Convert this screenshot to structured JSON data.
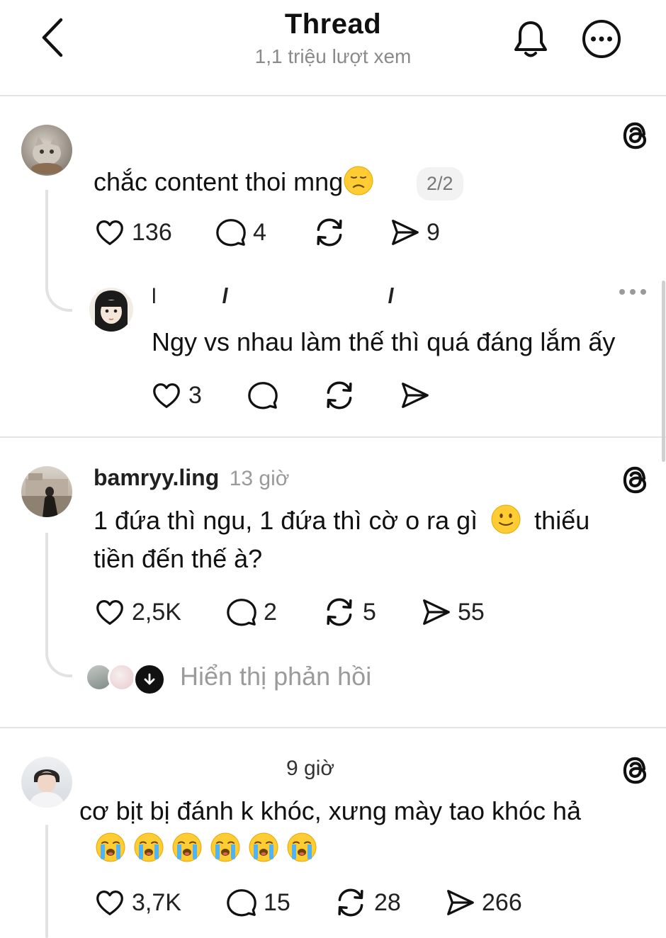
{
  "header": {
    "title": "Thread",
    "subtitle": "1,1 triệu lượt xem"
  },
  "posts": [
    {
      "text": "chắc content thoi mng",
      "page_badge": "2/2",
      "likes": "136",
      "comments": "4",
      "reposts": "",
      "shares": "9"
    },
    {
      "username": "l",
      "text": "Ngy vs nhau làm thế thì quá đáng lắm ấy",
      "likes": "3",
      "comments": "",
      "reposts": "",
      "shares": ""
    },
    {
      "username": "bamryy.ling",
      "time": "13 giờ",
      "text_line1": "1 đứa thì ngu, 1 đứa thì cờ o ra gì",
      "text_line1_tail": "thiếu",
      "text_line2": "tiền đến thế à?",
      "likes": "2,5K",
      "comments": "2",
      "reposts": "5",
      "shares": "55",
      "show_replies": "Hiển thị phản hồi"
    },
    {
      "time": "9 giờ",
      "text_line1": "cơ bịt bị đánh k khóc, xưng mày tao khóc hả",
      "likes": "3,7K",
      "comments": "15",
      "reposts": "28",
      "shares": "266"
    }
  ],
  "icons": {
    "back": "chevron-left-icon",
    "bell": "bell-icon",
    "more": "more-circle-icon",
    "threads": "threads-logo-icon",
    "heart": "heart-icon",
    "comment": "comment-icon",
    "repost": "repost-icon",
    "share": "send-icon"
  },
  "colors": {
    "text": "#101010",
    "muted": "#8a8a8a",
    "divider": "#e4e4e4",
    "emoji_yellow": "#FFCC33"
  }
}
